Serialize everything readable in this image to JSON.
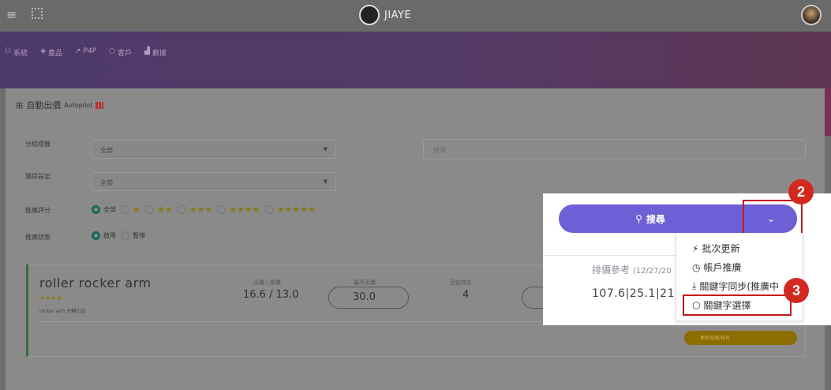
{
  "brand": {
    "name": "JIAYE"
  },
  "nav": {
    "items": [
      {
        "icon": "user-icon",
        "label": "系統"
      },
      {
        "icon": "layers-icon",
        "label": "產品"
      },
      {
        "icon": "send-icon",
        "label": "P4P"
      },
      {
        "icon": "chat-icon",
        "label": "客戶"
      },
      {
        "icon": "bar-chart-icon",
        "label": "數據"
      }
    ]
  },
  "card": {
    "title": "自動出價",
    "subtitle": "Autopilot"
  },
  "filters": {
    "group_label": "分組標籤",
    "group_value": "全部",
    "category_label": "類目設定",
    "category_value": "全部",
    "search_placeholder": "搜尋",
    "rating_label": "推廣評分",
    "rating_all": "全部",
    "status_label": "推廣狀態",
    "status_on": "啟用",
    "status_off": "暫停"
  },
  "item": {
    "title": "roller rocker arm",
    "stars": "★★★★",
    "subtitle": "rocker arm 分轉引流",
    "bid_label": "出價 / 底價",
    "bid_value": "16.6 / 13.0",
    "max_label": "最高出價",
    "max_value": "30.0",
    "rank_label": "目前排名",
    "rank_value": "4",
    "update_button": "更新出價/排名"
  },
  "popup": {
    "search_button": "搜尋",
    "ref_label": "排價參考",
    "ref_date": "(12/27/20",
    "ref_value": "107.6|25.1|21.",
    "menu": [
      "批次更新",
      "帳戶推廣",
      "關鍵字同步(推廣中",
      "關鍵字選擇"
    ],
    "badge2": "2",
    "badge3": "3"
  }
}
